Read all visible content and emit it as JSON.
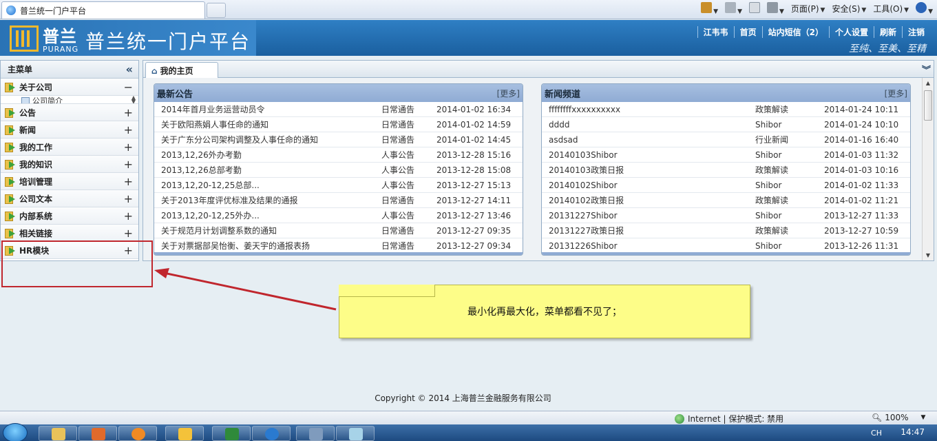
{
  "browser": {
    "tab_title": "普兰统一门户平台",
    "menus": [
      "页面(P)",
      "安全(S)",
      "工具(O)"
    ]
  },
  "header": {
    "logo_cn": "普兰",
    "logo_en": "PURANG",
    "title": "普兰统一门户平台",
    "links": [
      "江韦韦",
      "首页",
      "站内短信（2）",
      "个人设置",
      "刷新",
      "注销"
    ],
    "slogan": "至纯、至美、至精"
  },
  "sidebar": {
    "title": "主菜单",
    "first": {
      "label": "关于公司",
      "sign": "−",
      "sub": "公司简介"
    },
    "items": [
      {
        "label": "公告",
        "sign": "+"
      },
      {
        "label": "新闻",
        "sign": "+"
      },
      {
        "label": "我的工作",
        "sign": "+"
      },
      {
        "label": "我的知识",
        "sign": "+"
      },
      {
        "label": "培训管理",
        "sign": "+"
      },
      {
        "label": "公司文本",
        "sign": "+"
      },
      {
        "label": "内部系统",
        "sign": "+"
      },
      {
        "label": "相关链接",
        "sign": "+"
      },
      {
        "label": "HR模块",
        "sign": "+"
      }
    ]
  },
  "tabs": {
    "home": "我的主页"
  },
  "notices": {
    "title": "最新公告",
    "more": "[更多]",
    "rows": [
      {
        "title": "2014年首月业务运营动员令",
        "type": "日常通告",
        "time": "2014-01-02 16:34"
      },
      {
        "title": "关于欧阳燕娟人事任命的通知",
        "type": "日常通告",
        "time": "2014-01-02 14:59"
      },
      {
        "title": "关于广东分公司架构调整及人事任命的通知",
        "type": "日常通告",
        "time": "2014-01-02 14:45"
      },
      {
        "title": "2013,12,26外办考勤",
        "type": "人事公告",
        "time": "2013-12-28 15:16"
      },
      {
        "title": "2013,12,26总部考勤",
        "type": "人事公告",
        "time": "2013-12-28 15:08"
      },
      {
        "title": "2013,12,20-12,25总部...",
        "type": "人事公告",
        "time": "2013-12-27 15:13"
      },
      {
        "title": "关于2013年度评优标准及结果的通报",
        "type": "日常通告",
        "time": "2013-12-27 14:11"
      },
      {
        "title": "2013,12,20-12,25外办...",
        "type": "人事公告",
        "time": "2013-12-27 13:46"
      },
      {
        "title": "关于规范月计划调整系数的通知",
        "type": "日常通告",
        "time": "2013-12-27 09:35"
      },
      {
        "title": "关于对票据部吴怡衡、姜天宇的通报表扬",
        "type": "日常通告",
        "time": "2013-12-27 09:34"
      }
    ]
  },
  "news": {
    "title": "新闻频道",
    "more": "[更多]",
    "rows": [
      {
        "title": "ffffffffxxxxxxxxxx",
        "type": "政策解读",
        "time": "2014-01-24 10:11"
      },
      {
        "title": "dddd",
        "type": "Shibor",
        "time": "2014-01-24 10:10"
      },
      {
        "title": "asdsad",
        "type": "行业新闻",
        "time": "2014-01-16 16:40"
      },
      {
        "title": "20140103Shibor",
        "type": "Shibor",
        "time": "2014-01-03 11:32"
      },
      {
        "title": "20140103政策日报",
        "type": "政策解读",
        "time": "2014-01-03 10:16"
      },
      {
        "title": "20140102Shibor",
        "type": "Shibor",
        "time": "2014-01-02 11:33"
      },
      {
        "title": "20140102政策日报",
        "type": "政策解读",
        "time": "2014-01-02 11:21"
      },
      {
        "title": "20131227Shibor",
        "type": "Shibor",
        "time": "2013-12-27 11:33"
      },
      {
        "title": "20131227政策日报",
        "type": "政策解读",
        "time": "2013-12-27 10:59"
      },
      {
        "title": "20131226Shibor",
        "type": "Shibor",
        "time": "2013-12-26 11:31"
      }
    ]
  },
  "annotation": {
    "text": "最小化再最大化，菜单都看不见了；"
  },
  "footer": {
    "copyright": "Copyright © 2014 上海普兰金融服务有限公司"
  },
  "status": {
    "zone": "Internet | 保护模式: 禁用",
    "zoom": "100%"
  },
  "taskbar": {
    "clock": "14:47",
    "lang": "CH"
  },
  "colors": {
    "header": "#1f6cb0",
    "panel_head": "#9bb5da",
    "annotation_bg": "#fdfd88",
    "annotation_border": "#c0262d"
  }
}
